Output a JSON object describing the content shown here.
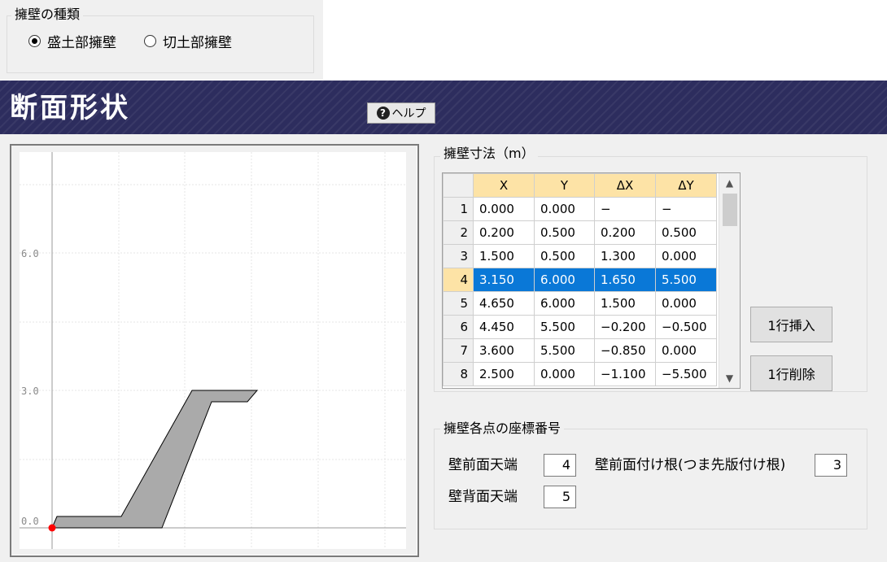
{
  "wall_type": {
    "title": "擁壁の種類",
    "options": [
      {
        "label": "盛土部擁壁",
        "checked": true
      },
      {
        "label": "切土部擁壁",
        "checked": false
      }
    ]
  },
  "header": {
    "title": "断面形状",
    "help_label": "ヘルプ",
    "help_icon": "question-circle-icon",
    "color": "#2d2d5e"
  },
  "plot": {
    "y_tick_labels": [
      "6.0",
      "3.0",
      "0.0"
    ],
    "shape_fill": "#aaaaaa",
    "origin_marker_color": "#ff0000"
  },
  "dimensions": {
    "title": "擁壁寸法（m）",
    "columns": [
      "X",
      "Y",
      "ΔX",
      "ΔY"
    ],
    "selected_row": 4,
    "rows": [
      {
        "n": "1",
        "x": "0.000",
        "y": "0.000",
        "dx": "−",
        "dy": "−"
      },
      {
        "n": "2",
        "x": "0.200",
        "y": "0.500",
        "dx": "0.200",
        "dy": "0.500"
      },
      {
        "n": "3",
        "x": "1.500",
        "y": "0.500",
        "dx": "1.300",
        "dy": "0.000"
      },
      {
        "n": "4",
        "x": "3.150",
        "y": "6.000",
        "dx": "1.650",
        "dy": "5.500"
      },
      {
        "n": "5",
        "x": "4.650",
        "y": "6.000",
        "dx": "1.500",
        "dy": "0.000"
      },
      {
        "n": "6",
        "x": "4.450",
        "y": "5.500",
        "dx": "−0.200",
        "dy": "−0.500"
      },
      {
        "n": "7",
        "x": "3.600",
        "y": "5.500",
        "dx": "−0.850",
        "dy": "0.000"
      },
      {
        "n": "8",
        "x": "2.500",
        "y": "0.000",
        "dx": "−1.100",
        "dy": "−5.500"
      }
    ],
    "insert_button": "1行挿入",
    "delete_button": "1行削除",
    "selection_color": "#0a78d7"
  },
  "coords": {
    "title": "擁壁各点の座標番号",
    "front_top_label": "壁前面天端",
    "front_top_value": "4",
    "front_root_label": "壁前面付け根(つま先版付け根)",
    "front_root_value": "3",
    "back_top_label": "壁背面天端",
    "back_top_value": "5"
  }
}
